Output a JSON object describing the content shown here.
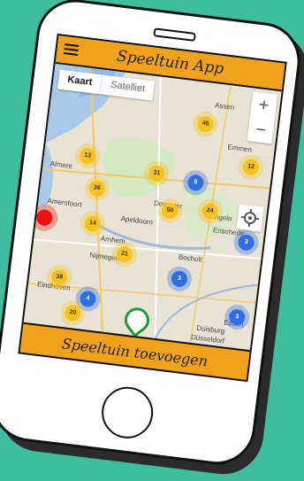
{
  "app": {
    "title": "Speeltuin App"
  },
  "map_type": {
    "map_label": "Kaart",
    "satellite_label": "Satelliet"
  },
  "zoom": {
    "in": "+",
    "out": "−"
  },
  "clusters": [
    {
      "label": "46",
      "color": "yellow"
    },
    {
      "label": "12",
      "color": "yellow"
    },
    {
      "label": "13",
      "color": "yellow"
    },
    {
      "label": "31",
      "color": "yellow"
    },
    {
      "label": "5",
      "color": "blue"
    },
    {
      "label": "36",
      "color": "yellow"
    },
    {
      "label": "50",
      "color": "yellow"
    },
    {
      "label": "24",
      "color": "yellow"
    },
    {
      "label": "",
      "color": "red"
    },
    {
      "label": "14",
      "color": "yellow"
    },
    {
      "label": "3",
      "color": "blue"
    },
    {
      "label": "21",
      "color": "yellow"
    },
    {
      "label": "3",
      "color": "blue"
    },
    {
      "label": "38",
      "color": "yellow"
    },
    {
      "label": "4",
      "color": "blue"
    },
    {
      "label": "20",
      "color": "yellow"
    },
    {
      "label": "3",
      "color": "blue"
    }
  ],
  "places": [
    "Assen",
    "Emmen",
    "Almere",
    "Amersfoort",
    "Apeldoorn",
    "Deventer",
    "Hengelo",
    "Enschede",
    "Arnhem",
    "Nijmegen",
    "Bocholt",
    "Eindhoven",
    "Essen",
    "Duisburg",
    "Düsseldorf"
  ],
  "footer": {
    "add_label": "Speeltuin toevoegen"
  },
  "colors": {
    "background": "#3fbd9f",
    "bar": "#f1a21c",
    "pin": "#1c9a3a"
  }
}
